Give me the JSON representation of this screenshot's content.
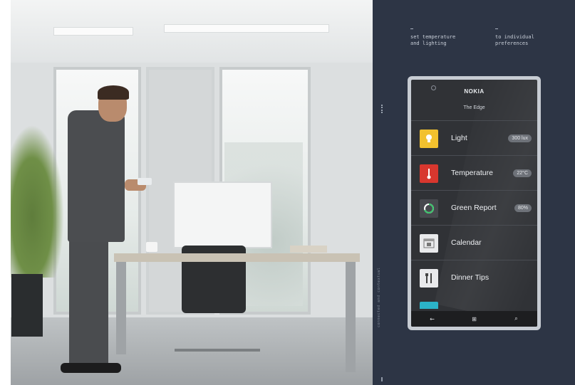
{
  "captions": {
    "left": "set temperature\nand lighting",
    "right": "to individual\npreferences"
  },
  "side_vertical_text": "connected and contextual",
  "phone": {
    "brand": "NOKIA",
    "subtitle": "The Edge",
    "items": [
      {
        "label": "Light",
        "value": "300 lux",
        "icon": "lightbulb-icon",
        "color": "#f2c12e"
      },
      {
        "label": "Temperature",
        "value": "22°C",
        "icon": "thermometer-icon",
        "color": "#d8372e"
      },
      {
        "label": "Green Report",
        "value": "80%",
        "icon": "ring-icon",
        "color": "#47494e"
      },
      {
        "label": "Calendar",
        "value": "",
        "icon": "calendar-icon",
        "color": "#e9eaec"
      },
      {
        "label": "Dinner Tips",
        "value": "",
        "icon": "cutlery-icon",
        "color": "#e9eaec"
      }
    ],
    "nav": {
      "back": "←",
      "home": "⊞",
      "search": "⌕"
    }
  },
  "colors": {
    "panel": "#2d3545",
    "accent_cyan": "#2bb3c8"
  }
}
